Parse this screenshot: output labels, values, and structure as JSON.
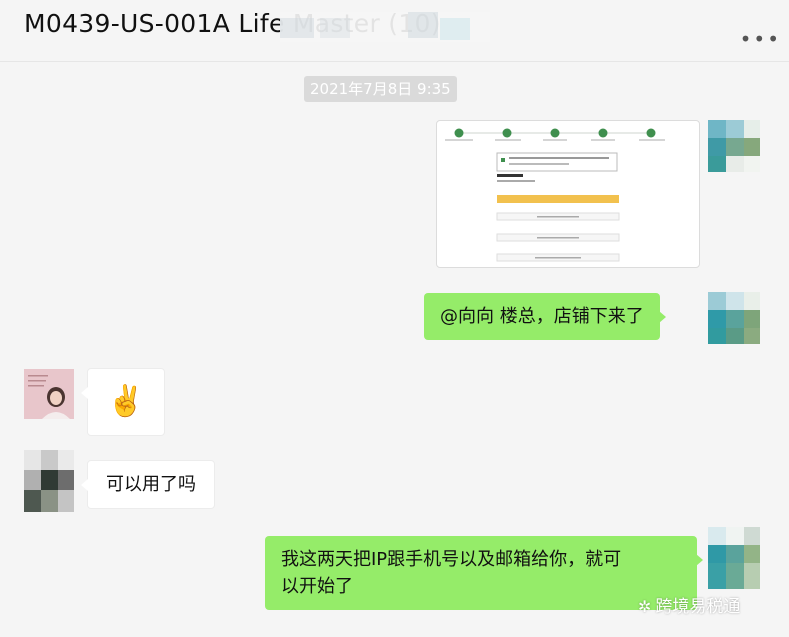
{
  "window": {
    "title": "M0439-US-001A Life Master  (10)",
    "more_icon": "more-horizontal-icon"
  },
  "chat": {
    "timestamp": "2021年7月8日 9:35",
    "messages": [
      {
        "id": "m1",
        "sender": "self",
        "kind": "image",
        "description": "screenshot-attachment"
      },
      {
        "id": "m2",
        "sender": "self",
        "kind": "text",
        "text": "@向向 楼总，店铺下来了"
      },
      {
        "id": "m3",
        "sender": "other",
        "kind": "emoji",
        "text": "✌️"
      },
      {
        "id": "m4",
        "sender": "other2",
        "kind": "text",
        "text": "可以用了吗"
      },
      {
        "id": "m5",
        "sender": "self",
        "kind": "text",
        "lines": [
          "我这两天把IP跟手机号以及邮箱给你，就可",
          "以开始了"
        ]
      }
    ]
  },
  "watermark": {
    "icon": "wechat-official-account-icon",
    "text": "跨境易税通"
  },
  "colors": {
    "self_bubble": "#95ec69",
    "other_bubble": "#ffffff",
    "background": "#f5f5f5",
    "timestamp_bg": "#dadada"
  }
}
